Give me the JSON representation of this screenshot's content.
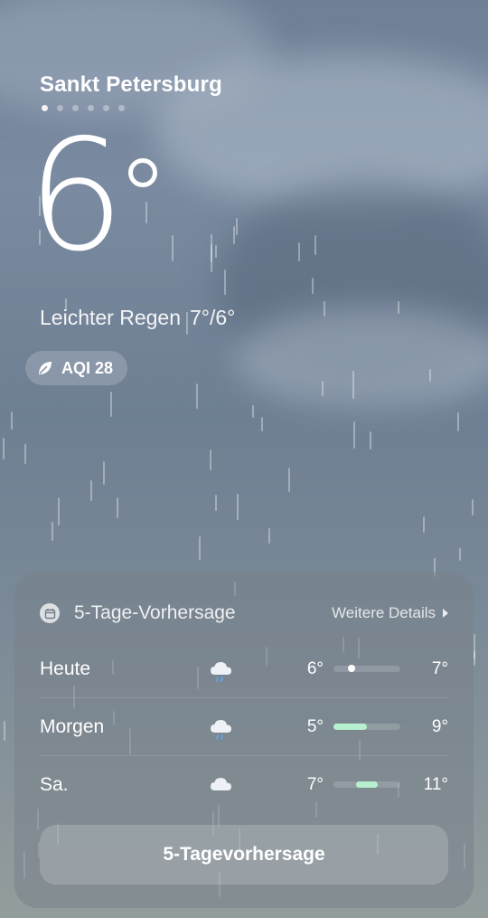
{
  "location": {
    "city": "Sankt Petersburg",
    "page_count": 6,
    "active_page": 0
  },
  "current": {
    "temperature": "6",
    "condition": "Leichter Regen",
    "high_low": "7°/6°",
    "aqi_label": "AQI 28"
  },
  "forecast": {
    "title": "5-Tage-Vorhersage",
    "more_label": "Weitere Details",
    "range_min": 5,
    "range_max": 11,
    "days": [
      {
        "day": "Heute",
        "icon": "rain-cloud-icon",
        "low": "6°",
        "high": "7°",
        "low_val": 6,
        "high_val": 7,
        "current": 6
      },
      {
        "day": "Morgen",
        "icon": "rain-cloud-icon",
        "low": "5°",
        "high": "9°",
        "low_val": 5,
        "high_val": 8
      },
      {
        "day": "Sa.",
        "icon": "cloud-icon",
        "low": "7°",
        "high": "11°",
        "low_val": 7,
        "high_val": 9
      }
    ],
    "button_label": "5-Tagevorhersage"
  },
  "colors": {
    "bar_fill": "#b7f0cf"
  }
}
